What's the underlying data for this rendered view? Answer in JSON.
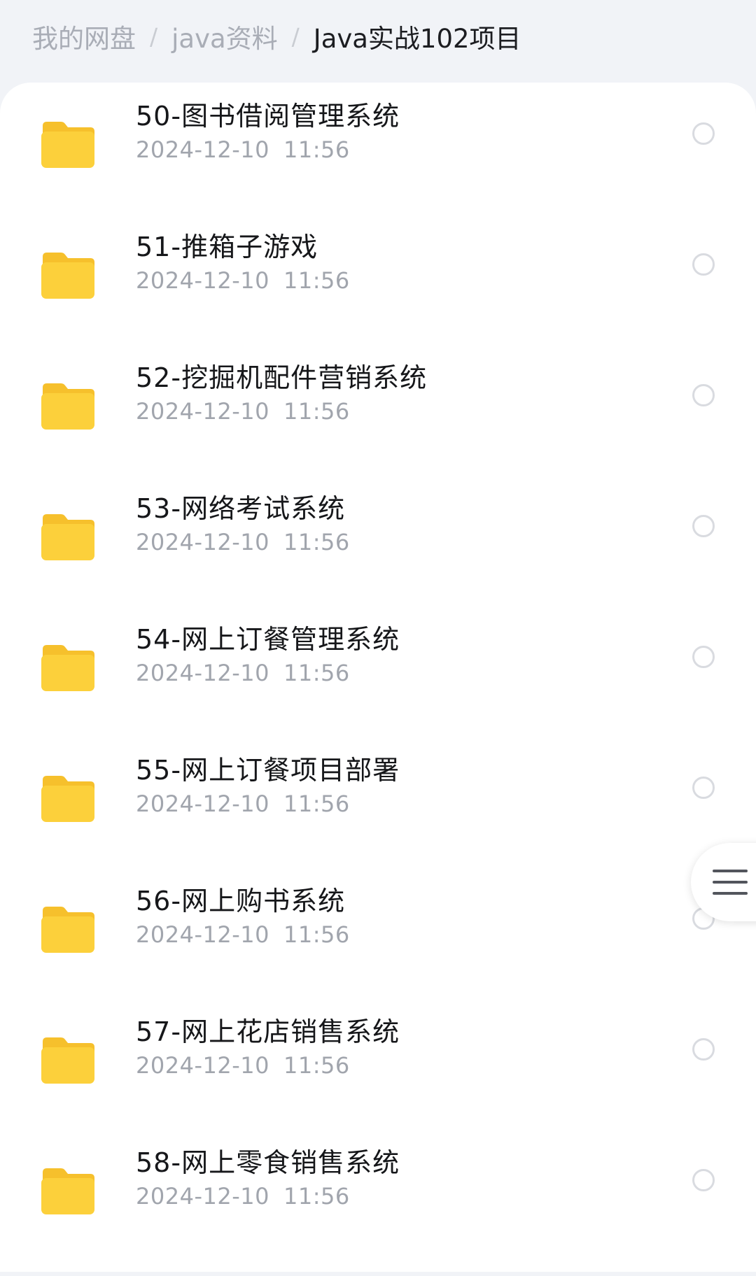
{
  "breadcrumb": {
    "items": [
      "我的网盘",
      "java资料",
      "Java实战102项目"
    ],
    "separator": "/"
  },
  "files": [
    {
      "name": "50-图书借阅管理系统",
      "date": "2024-12-10",
      "time": "11:56",
      "icon": "folder-icon"
    },
    {
      "name": "51-推箱子游戏",
      "date": "2024-12-10",
      "time": "11:56",
      "icon": "folder-icon"
    },
    {
      "name": "52-挖掘机配件营销系统",
      "date": "2024-12-10",
      "time": "11:56",
      "icon": "folder-icon"
    },
    {
      "name": "53-网络考试系统",
      "date": "2024-12-10",
      "time": "11:56",
      "icon": "folder-icon"
    },
    {
      "name": "54-网上订餐管理系统",
      "date": "2024-12-10",
      "time": "11:56",
      "icon": "folder-icon"
    },
    {
      "name": "55-网上订餐项目部署",
      "date": "2024-12-10",
      "time": "11:56",
      "icon": "folder-icon"
    },
    {
      "name": "56-网上购书系统",
      "date": "2024-12-10",
      "time": "11:56",
      "icon": "folder-icon"
    },
    {
      "name": "57-网上花店销售系统",
      "date": "2024-12-10",
      "time": "11:56",
      "icon": "folder-icon"
    },
    {
      "name": "58-网上零食销售系统",
      "date": "2024-12-10",
      "time": "11:56",
      "icon": "folder-icon"
    }
  ],
  "floating_menu": {
    "icon": "menu-icon"
  },
  "colors": {
    "folder": "#fcd03b",
    "folder_tab": "#f6c02c",
    "background": "#f1f3f7",
    "card": "#ffffff",
    "text_primary": "#16171a",
    "text_secondary": "#a1a5ad"
  }
}
